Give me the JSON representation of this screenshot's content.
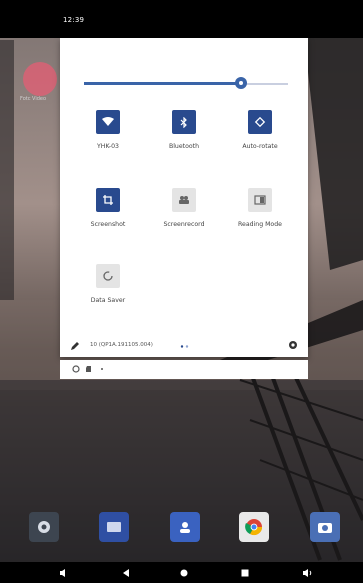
{
  "status_bar": {
    "time": "12:39"
  },
  "home": {
    "ghost_app_label": "Fotc Video"
  },
  "quick_settings": {
    "brightness": {
      "level": 0.77
    },
    "tiles": [
      {
        "label": "YHK-03",
        "icon": "wifi-icon",
        "state": "on"
      },
      {
        "label": "Bluetooth",
        "icon": "bluetooth-icon",
        "state": "on"
      },
      {
        "label": "Auto-rotate",
        "icon": "auto-rotate-icon",
        "state": "on"
      },
      {
        "label": "Screenshot",
        "icon": "screenshot-icon",
        "state": "on"
      },
      {
        "label": "Screenrecord",
        "icon": "screenrecord-icon",
        "state": "off"
      },
      {
        "label": "Reading Mode",
        "icon": "reading-mode-icon",
        "state": "off"
      },
      {
        "label": "Data Saver",
        "icon": "data-saver-icon",
        "state": "off"
      }
    ],
    "build_number": "10 (QP1A.191105.004)"
  },
  "dock": {
    "apps": [
      "settings-icon",
      "messages-icon",
      "contacts-icon",
      "chrome-icon",
      "camera-icon"
    ]
  },
  "colors": {
    "accent": "#294a8e",
    "slider": "#3a64a8"
  }
}
